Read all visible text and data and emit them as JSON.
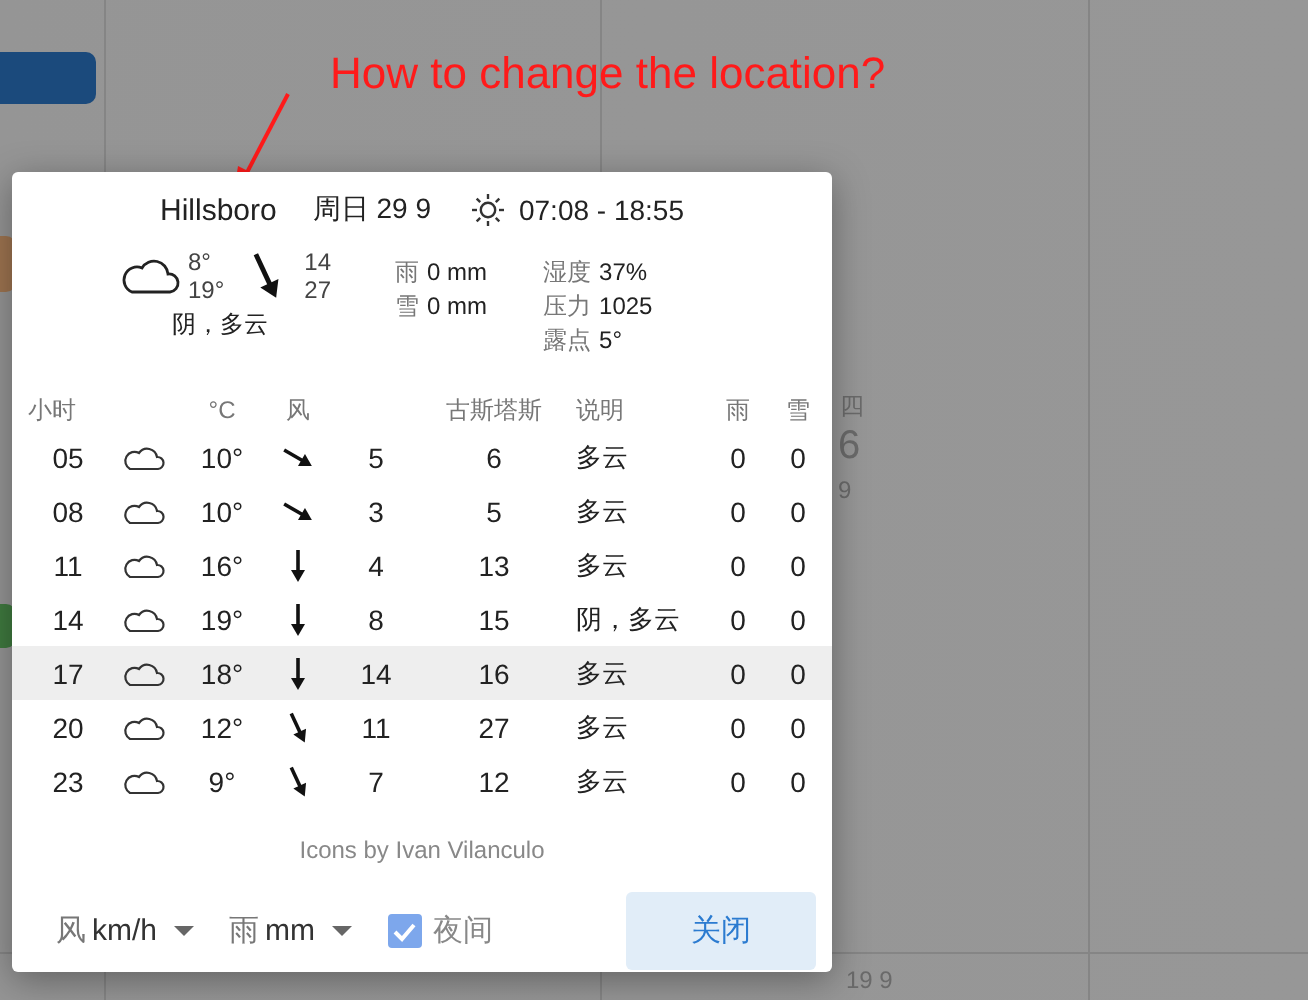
{
  "annotation": {
    "text": "How to change the location?"
  },
  "background": {
    "day_name": "四",
    "day_number": "6",
    "day_month": "9",
    "bottom_date": "19 9"
  },
  "dialog": {
    "location": "Hillsboro",
    "date": "周日 29 9",
    "sun_times": "07:08 - 18:55",
    "summary": {
      "temp_low": "8°",
      "temp_high": "19°",
      "wind": {
        "kind": "sse",
        "speed": "14",
        "gusts": "27"
      },
      "description": "阴，多云",
      "precip": [
        {
          "label": "雨",
          "value": "0 mm"
        },
        {
          "label": "雪",
          "value": "0 mm"
        }
      ],
      "stats": [
        {
          "label": "湿度",
          "value": "37%"
        },
        {
          "label": "压力",
          "value": "1025"
        },
        {
          "label": "露点",
          "value": "5°"
        }
      ]
    },
    "table": {
      "columns": [
        "小时",
        "°C",
        "风",
        "古斯塔斯",
        "说明",
        "雨",
        "雪"
      ],
      "rows": [
        {
          "hour": "05",
          "temp": "10°",
          "wind": {
            "kind": "se",
            "speed": "5"
          },
          "gusts": "6",
          "description": "多云",
          "rain": "0",
          "snow": "0",
          "selected": false
        },
        {
          "hour": "08",
          "temp": "10°",
          "wind": {
            "kind": "se",
            "speed": "3"
          },
          "gusts": "5",
          "description": "多云",
          "rain": "0",
          "snow": "0",
          "selected": false
        },
        {
          "hour": "11",
          "temp": "16°",
          "wind": {
            "kind": "s",
            "speed": "4"
          },
          "gusts": "13",
          "description": "多云",
          "rain": "0",
          "snow": "0",
          "selected": false
        },
        {
          "hour": "14",
          "temp": "19°",
          "wind": {
            "kind": "s",
            "speed": "8"
          },
          "gusts": "15",
          "description": "阴，多云",
          "rain": "0",
          "snow": "0",
          "selected": false
        },
        {
          "hour": "17",
          "temp": "18°",
          "wind": {
            "kind": "s",
            "speed": "14"
          },
          "gusts": "16",
          "description": "多云",
          "rain": "0",
          "snow": "0",
          "selected": true
        },
        {
          "hour": "20",
          "temp": "12°",
          "wind": {
            "kind": "sse",
            "speed": "11"
          },
          "gusts": "27",
          "description": "多云",
          "rain": "0",
          "snow": "0",
          "selected": false
        },
        {
          "hour": "23",
          "temp": "9°",
          "wind": {
            "kind": "sse",
            "speed": "7"
          },
          "gusts": "12",
          "description": "多云",
          "rain": "0",
          "snow": "0",
          "selected": false
        }
      ]
    },
    "credit": "Icons by Ivan Vilanculo",
    "footer": {
      "wind_unit": {
        "label": "风",
        "value": "km/h"
      },
      "rain_unit": {
        "label": "雨",
        "value": "mm"
      },
      "night": {
        "label": "夜间",
        "checked": true
      },
      "close_button": "关闭"
    }
  }
}
